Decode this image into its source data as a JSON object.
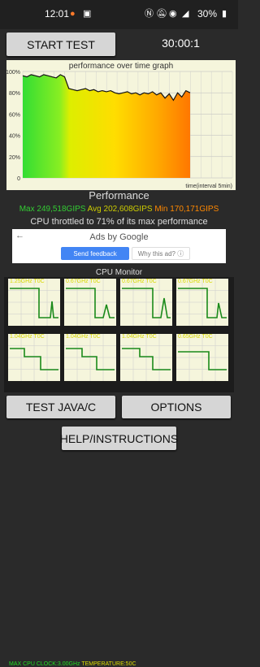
{
  "status_bar": {
    "time": "12:01",
    "battery": "30%",
    "icons": [
      "app-icon",
      "calendar-icon",
      "nfc-icon",
      "mute-icon",
      "wifi-icon",
      "signal-icon",
      "battery-icon"
    ]
  },
  "controls": {
    "start_label": "START TEST",
    "timer": "30:00:1"
  },
  "graph": {
    "title": "performance over time graph",
    "y_ticks": [
      "100%",
      "80%",
      "60%",
      "40%",
      "20%",
      "0"
    ],
    "x_label": "time(interval 5min)"
  },
  "chart_data": {
    "type": "line",
    "title": "performance over time graph",
    "xlabel": "time(interval 5min)",
    "ylabel": "",
    "ylim": [
      0,
      100
    ],
    "x": [
      0,
      1,
      2,
      3,
      4,
      5,
      6,
      7,
      8,
      9,
      10,
      11,
      12,
      13,
      14,
      15,
      16,
      17,
      18,
      19,
      20,
      21,
      22,
      23,
      24,
      25,
      26,
      27,
      28,
      29,
      30,
      31,
      32,
      33,
      34,
      35,
      36,
      37,
      38,
      39,
      40
    ],
    "values": [
      96,
      95,
      97,
      96,
      95,
      97,
      96,
      95,
      94,
      97,
      95,
      84,
      83,
      82,
      83,
      84,
      82,
      83,
      81,
      82,
      81,
      82,
      80,
      79,
      80,
      81,
      79,
      80,
      78,
      80,
      79,
      81,
      78,
      80,
      75,
      79,
      73,
      80,
      76,
      82,
      80
    ]
  },
  "performance": {
    "title": "Performance",
    "max": "Max 249,518GIPS",
    "avg": "Avg 202,608GIPS",
    "min": "Min 170,171GIPS",
    "throttle_text": "CPU throttled to 71% of its max performance",
    "colors": {
      "max": "#33cc33",
      "avg": "#cccc00",
      "min": "#ff8800"
    }
  },
  "ad": {
    "ads_by": "Ads by Google",
    "send_feedback": "Send feedback",
    "why": "Why this ad?"
  },
  "cpu_monitor": {
    "title": "CPU Monitor",
    "cores": [
      {
        "freq": "1.25GHz",
        "temp": "T0C"
      },
      {
        "freq": "0.67GHz",
        "temp": "T0C"
      },
      {
        "freq": "0.67GHz",
        "temp": "T0C"
      },
      {
        "freq": "0.67GHz",
        "temp": "T0C"
      },
      {
        "freq": "1.04GHz",
        "temp": "T0C"
      },
      {
        "freq": "1.04GHz",
        "temp": "T0C"
      },
      {
        "freq": "1.04GHz",
        "temp": "T0C"
      },
      {
        "freq": "0.65GHz",
        "temp": "T0C"
      }
    ],
    "max_clock": "MAX CPU CLOCK:3.00GHz",
    "temperature": "TEMPERATURE:50C"
  },
  "buttons": {
    "test_java": "TEST JAVA/C",
    "options": "OPTIONS",
    "help": "HELP/INSTRUCTIONS"
  }
}
